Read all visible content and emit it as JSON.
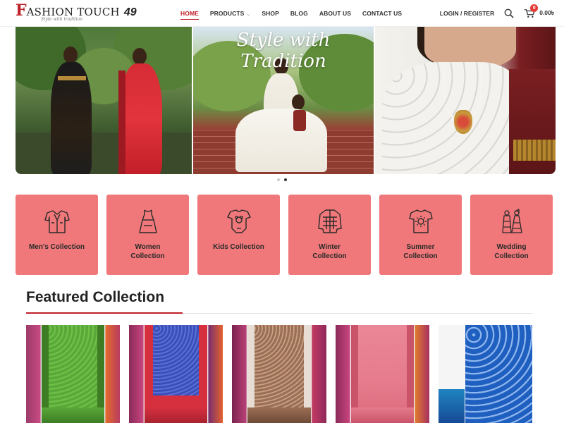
{
  "brand": {
    "initial": "F",
    "name": "ASHION TOUCH",
    "number": "49",
    "tagline": "Style with tradition",
    "accent_color": "#c0202a"
  },
  "nav": {
    "items": [
      {
        "label": "HOME",
        "active": true
      },
      {
        "label": "PRODUCTS",
        "active": false,
        "has_dropdown": true
      },
      {
        "label": "SHOP",
        "active": false
      },
      {
        "label": "BLOG",
        "active": false
      },
      {
        "label": "ABOUT US",
        "active": false
      },
      {
        "label": "CONTACT US",
        "active": false
      }
    ],
    "dropdown_caret": "⌄"
  },
  "header_right": {
    "login_label": "LOGIN / REGISTER",
    "search_icon": "search-icon",
    "cart_icon": "cart-icon",
    "cart_count": "0",
    "cart_total": "0.00৳"
  },
  "hero": {
    "title": "Style with Tradition",
    "slides_total": 2,
    "active_slide": 2
  },
  "categories": [
    {
      "label": "Men's Collection",
      "icon": "men-clothing-icon"
    },
    {
      "label": "Women Collection",
      "icon": "women-dress-icon"
    },
    {
      "label": "Kids Collection",
      "icon": "kids-romper-icon"
    },
    {
      "label": "Winter Collection",
      "icon": "winter-jacket-icon"
    },
    {
      "label": "Summer Collection",
      "icon": "summer-shirt-icon"
    },
    {
      "label": "Wedding Collection",
      "icon": "wedding-couple-icon"
    }
  ],
  "category_color": "#f0787a",
  "featured": {
    "title": "Featured Collection",
    "products": [
      {
        "name": "green-saree",
        "color": "#5aa83a",
        "border": "#3e7d24"
      },
      {
        "name": "blue-red-saree",
        "color": "#3a4fb8",
        "border": "#d6303f"
      },
      {
        "name": "brown-saree",
        "color": "#9b6f55",
        "border": "#6e4a36"
      },
      {
        "name": "pink-saree",
        "color": "#e57b8c",
        "border": "#c9546a"
      },
      {
        "name": "blue-print-saree",
        "color": "#1f5fc0",
        "border": "#164a96"
      }
    ]
  }
}
